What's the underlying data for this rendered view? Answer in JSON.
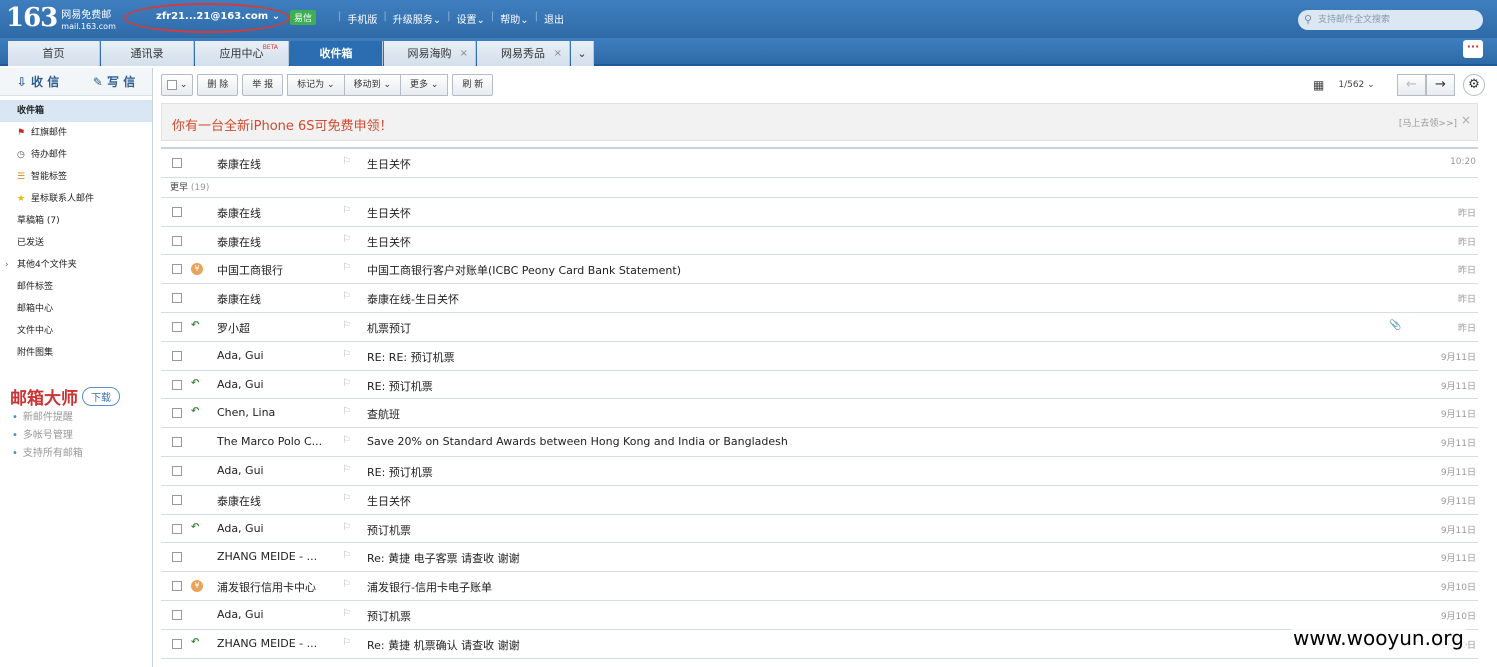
{
  "header": {
    "logo_num": "163",
    "logo_line1": "网易免费邮",
    "logo_line2": "mail.163.com",
    "account": "zfr21...21@163.com ⌄",
    "yixin": "易信",
    "nav": [
      "手机版",
      "升级服务⌄",
      "设置⌄",
      "帮助⌄",
      "退出"
    ],
    "search_placeholder": "支持邮件全文搜索"
  },
  "tabs": [
    {
      "label": "首页",
      "close": ""
    },
    {
      "label": "通讯录",
      "close": ""
    },
    {
      "label": "应用中心",
      "close": ""
    },
    {
      "label": "收件箱",
      "close": ""
    },
    {
      "label": "网易海购",
      "close": "×"
    },
    {
      "label": "网易秀品",
      "close": "×"
    }
  ],
  "tab_beta": "BETA",
  "tab_more": "⌄",
  "sidebar": {
    "receive": "收 信",
    "compose": "写 信",
    "folders": [
      {
        "label": "收件箱",
        "icon": ""
      },
      {
        "label": "红旗邮件",
        "icon": "⚑"
      },
      {
        "label": "待办邮件",
        "icon": "◷"
      },
      {
        "label": "智能标签",
        "icon": "☰"
      },
      {
        "label": "星标联系人邮件",
        "icon": "★"
      },
      {
        "label": "草稿箱 (7)",
        "icon": ""
      },
      {
        "label": "已发送",
        "icon": ""
      },
      {
        "label": "其他4个文件夹",
        "icon": ""
      },
      {
        "label": "邮件标签",
        "icon": ""
      },
      {
        "label": "邮箱中心",
        "icon": ""
      },
      {
        "label": "文件中心",
        "icon": ""
      },
      {
        "label": "附件图集",
        "icon": ""
      }
    ],
    "promo_title": "邮箱大师",
    "promo_download": "下载",
    "promo_lines": [
      "新邮件提醒",
      "多帐号管理",
      "支持所有邮箱"
    ]
  },
  "toolbar": {
    "delete": "删 除",
    "report": "举 报",
    "mark": "标记为 ⌄",
    "move": "移动到 ⌄",
    "more": "更多 ⌄",
    "refresh": "刷 新",
    "page": "1/562 ⌄"
  },
  "banner": {
    "text": "你有一台全新iPhone 6S可免费申领！",
    "link": "[马上去领>>]",
    "close": "×"
  },
  "group_label": "更早",
  "group_count": "(19)",
  "mails": [
    {
      "from": "泰康在线",
      "subject": "生日关怀",
      "date": "10:20",
      "status": "",
      "att": ""
    },
    {
      "from": "泰康在线",
      "subject": "生日关怀",
      "date": "昨日",
      "status": "",
      "att": ""
    },
    {
      "from": "泰康在线",
      "subject": "生日关怀",
      "date": "昨日",
      "status": "",
      "att": ""
    },
    {
      "from": "中国工商银行",
      "subject": "中国工商银行客户对账单(ICBC Peony Card Bank Statement)",
      "date": "昨日",
      "status": "coin",
      "att": ""
    },
    {
      "from": "泰康在线",
      "subject": "泰康在线-生日关怀",
      "date": "昨日",
      "status": "",
      "att": ""
    },
    {
      "from": "罗小超",
      "subject": "机票预订",
      "date": "昨日",
      "status": "reply",
      "att": "📎"
    },
    {
      "from": "Ada, Gui",
      "subject": "RE: RE: 预订机票",
      "date": "9月11日",
      "status": "",
      "att": ""
    },
    {
      "from": "Ada, Gui",
      "subject": "RE: 预订机票",
      "date": "9月11日",
      "status": "reply",
      "att": ""
    },
    {
      "from": "Chen, Lina",
      "subject": "查航班",
      "date": "9月11日",
      "status": "reply",
      "att": ""
    },
    {
      "from": "The Marco Polo C...",
      "subject": "Save 20% on Standard Awards between Hong Kong and India or Bangladesh",
      "date": "9月11日",
      "status": "",
      "att": ""
    },
    {
      "from": "Ada, Gui",
      "subject": "RE: 预订机票",
      "date": "9月11日",
      "status": "",
      "att": ""
    },
    {
      "from": "泰康在线",
      "subject": "生日关怀",
      "date": "9月11日",
      "status": "",
      "att": ""
    },
    {
      "from": "Ada, Gui",
      "subject": "预订机票",
      "date": "9月11日",
      "status": "reply",
      "att": ""
    },
    {
      "from": "ZHANG MEIDE - ...",
      "subject": "Re: 黄捷 电子客票 请查收 谢谢",
      "date": "9月11日",
      "status": "",
      "att": ""
    },
    {
      "from": "浦发银行信用卡中心",
      "subject": "浦发银行-信用卡电子账单",
      "date": "9月10日",
      "status": "coin",
      "att": ""
    },
    {
      "from": "Ada, Gui",
      "subject": "预订机票",
      "date": "9月10日",
      "status": "",
      "att": ""
    },
    {
      "from": "ZHANG MEIDE - ...",
      "subject": "Re: 黄捷 机票确认 请查收 谢谢",
      "date": "9月10日",
      "status": "reply",
      "att": ""
    }
  ],
  "watermark": "www.wooyun.org"
}
